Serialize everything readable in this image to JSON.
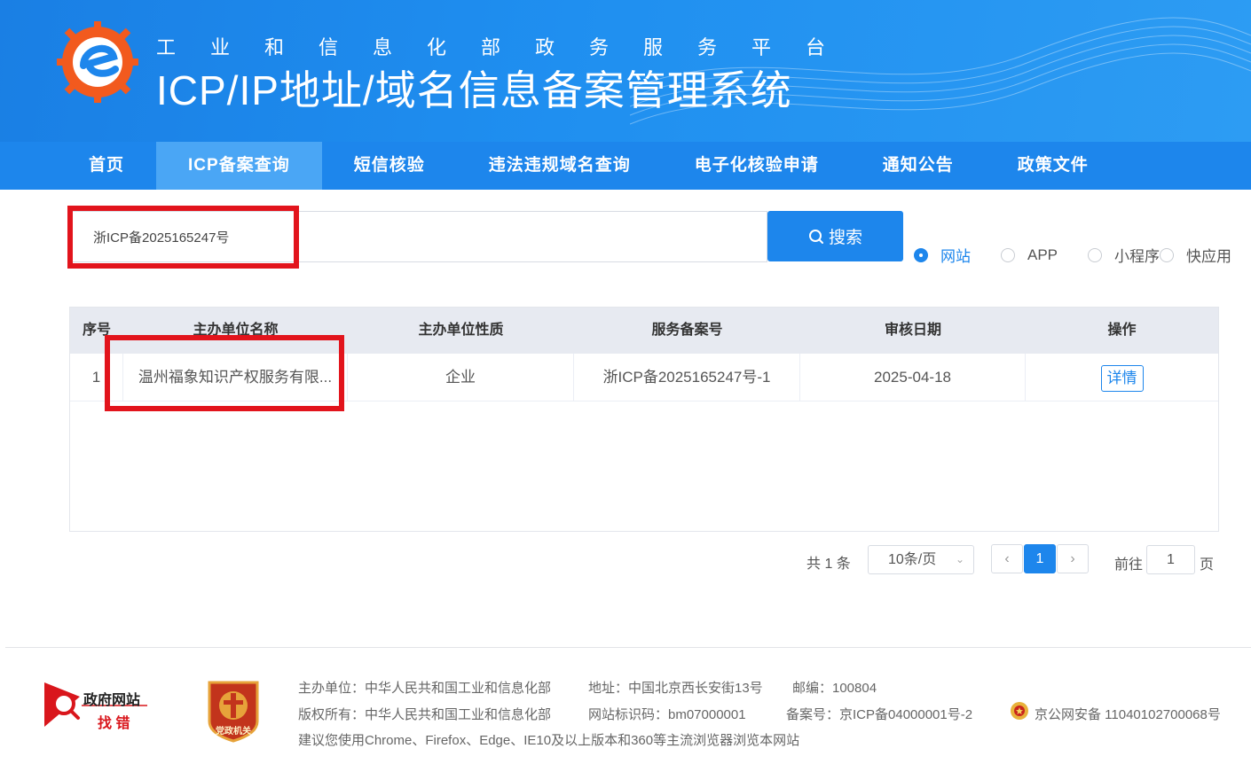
{
  "header": {
    "subtitle": "工业和信息化部政务服务平台",
    "title": "ICP/IP地址/域名信息备案管理系统"
  },
  "nav": {
    "items": [
      {
        "label": "首页"
      },
      {
        "label": "ICP备案查询"
      },
      {
        "label": "短信核验"
      },
      {
        "label": "违法违规域名查询"
      },
      {
        "label": "电子化核验申请"
      },
      {
        "label": "通知公告"
      },
      {
        "label": "政策文件"
      }
    ],
    "active_index": 1
  },
  "search": {
    "value": "浙ICP备2025165247号",
    "button_label": "搜索"
  },
  "radios": {
    "options": [
      "网站",
      "APP",
      "小程序",
      "快应用"
    ],
    "selected": "网站"
  },
  "table": {
    "headers": [
      "序号",
      "主办单位名称",
      "主办单位性质",
      "服务备案号",
      "审核日期",
      "操作"
    ],
    "rows": [
      {
        "index": "1",
        "name": "温州福象知识产权服务有限...",
        "nature": "企业",
        "record_no": "浙ICP备2025165247号-1",
        "date": "2025-04-18",
        "action": "详情"
      }
    ]
  },
  "pagination": {
    "total_text": "共 1 条",
    "page_size": "10条/页",
    "prev": "‹",
    "current_page": "1",
    "next": "›",
    "goto_label": "前往",
    "goto_value": "1",
    "page_suffix": "页"
  },
  "footer": {
    "gov_logo_line1": "政府网站",
    "gov_logo_line2": "找 错",
    "party_logo_text": "党政机关",
    "line1": [
      "主办单位：中华人民共和国工业和信息化部",
      "地址：中国北京西长安街13号",
      "邮编：100804"
    ],
    "line2": [
      "版权所有：中华人民共和国工业和信息化部",
      "网站标识码：bm07000001",
      "备案号：京ICP备04000001号-2",
      "京公网安备 11040102700068号"
    ],
    "line3": "建议您使用Chrome、Firefox、Edge、IE10及以上版本和360等主流浏览器浏览本网站"
  },
  "colors": {
    "primary": "#1d86ec",
    "highlight_box": "#e2141c"
  }
}
